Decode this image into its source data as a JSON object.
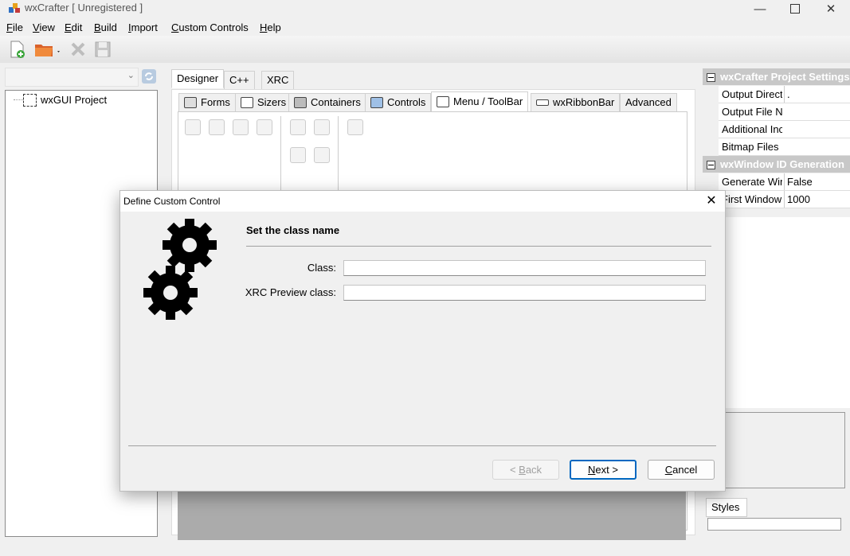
{
  "window": {
    "title": "wxCrafter [ Unregistered ]"
  },
  "menu": [
    {
      "label": "File",
      "ul": "F",
      "rest": "ile"
    },
    {
      "label": "View",
      "ul": "V",
      "rest": "iew"
    },
    {
      "label": "Edit",
      "ul": "E",
      "rest": "dit"
    },
    {
      "label": "Build",
      "ul": "B",
      "rest": "uild"
    },
    {
      "label": "Import",
      "ul": "I",
      "rest": "mport"
    },
    {
      "label": "Custom Controls",
      "ul": "C",
      "rest": "ustom Controls"
    },
    {
      "label": "Help",
      "ul": "H",
      "rest": "elp"
    }
  ],
  "tree": {
    "root_label": "wxGUI Project"
  },
  "tabs": [
    "Designer",
    "C++",
    "XRC"
  ],
  "subtabs": [
    "Forms",
    "Sizers",
    "Containers",
    "Controls",
    "Menu / ToolBar",
    "wxRibbonBar",
    "Advanced"
  ],
  "properties": {
    "group1": "wxCrafter Project Settings",
    "rows1": [
      {
        "key": "Output Directory",
        "value": "."
      },
      {
        "key": "Output File Name",
        "value": ""
      },
      {
        "key": "Additional Include Files",
        "value": ""
      },
      {
        "key": "Bitmap Files",
        "value": ""
      }
    ],
    "group2": "wxWindow ID Generation",
    "rows2": [
      {
        "key": "Generate Window IDs",
        "value": "False"
      },
      {
        "key": "First Window ID",
        "value": "1000"
      }
    ],
    "styles_tab": "Styles"
  },
  "dialog": {
    "title": "Define Custom Control",
    "heading": "Set the class name",
    "class_label": "Class:",
    "class_value": "",
    "xrc_label": "XRC Preview class:",
    "xrc_value": "",
    "back": {
      "pre": "< ",
      "ul": "B",
      "rest": "ack"
    },
    "next": {
      "pre": "",
      "ul": "N",
      "rest": "ext >"
    },
    "cancel": {
      "pre": "",
      "ul": "C",
      "rest": "ancel"
    }
  }
}
